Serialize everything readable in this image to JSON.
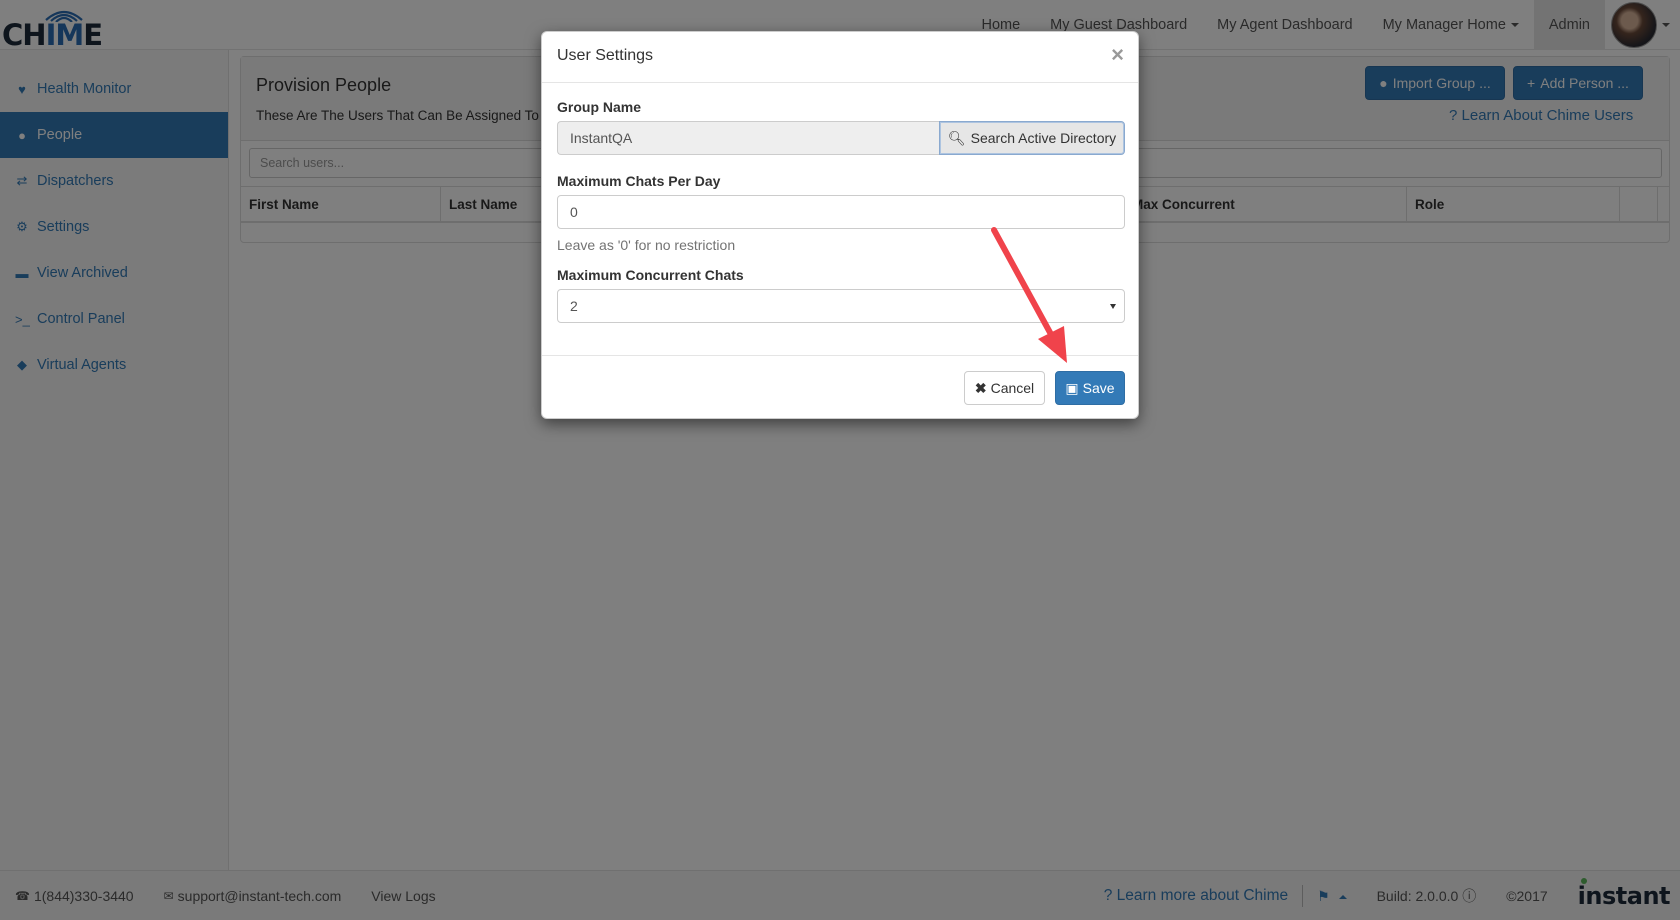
{
  "brand": {
    "logo_text_pre": "CH",
    "logo_text_mid": "IM",
    "logo_text_post": "E"
  },
  "nav": {
    "items": [
      {
        "label": "Home"
      },
      {
        "label": "My Guest Dashboard"
      },
      {
        "label": "My Agent Dashboard"
      },
      {
        "label": "My Manager Home"
      },
      {
        "label": "Admin"
      }
    ]
  },
  "sidebar": {
    "items": [
      {
        "label": "Health Monitor",
        "icon": "heartbeat-icon"
      },
      {
        "label": "People",
        "icon": "users-icon"
      },
      {
        "label": "Dispatchers",
        "icon": "exchange-icon"
      },
      {
        "label": "Settings",
        "icon": "cogs-icon"
      },
      {
        "label": "View Archived",
        "icon": "archive-icon"
      },
      {
        "label": "Control Panel",
        "icon": "terminal-icon"
      },
      {
        "label": "Virtual Agents",
        "icon": "android-icon"
      }
    ]
  },
  "main": {
    "title": "Provision People",
    "subtitle": "These Are The Users That Can Be Assigned To",
    "import_label": "Import Group ...",
    "add_label": "Add Person ...",
    "learn_label": "Learn About Chime Users",
    "search_placeholder": "Search users...",
    "columns": [
      "First Name",
      "Last Name",
      "",
      "Max Concurrent",
      "Role",
      "",
      ""
    ]
  },
  "modal": {
    "title": "User Settings",
    "close": "×",
    "group_label": "Group Name",
    "group_value": "InstantQA",
    "search_ad_label": "Search Active Directory",
    "max_chats_label": "Maximum Chats Per Day",
    "max_chats_value": "0",
    "max_chats_help": "Leave as '0' for no restriction",
    "max_concurrent_label": "Maximum Concurrent Chats",
    "max_concurrent_value": "2",
    "cancel_label": "Cancel",
    "save_label": "Save"
  },
  "footer": {
    "phone": "1(844)330-3440",
    "email": "support@instant-tech.com",
    "logs": "View Logs",
    "learn_more": "Learn more about Chime",
    "build": "Build: 2.0.0.0",
    "copyright": "©2017",
    "company_logo": "instant"
  },
  "colors": {
    "primary": "#337ab7",
    "annotation_arrow": "#f0434b"
  }
}
